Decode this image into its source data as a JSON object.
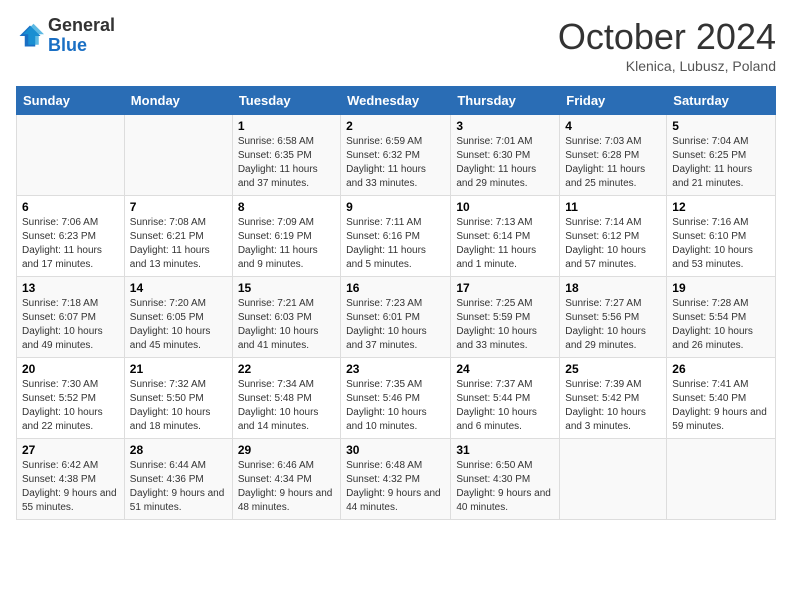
{
  "header": {
    "logo_general": "General",
    "logo_blue": "Blue",
    "title": "October 2024",
    "subtitle": "Klenica, Lubusz, Poland"
  },
  "weekdays": [
    "Sunday",
    "Monday",
    "Tuesday",
    "Wednesday",
    "Thursday",
    "Friday",
    "Saturday"
  ],
  "weeks": [
    [
      {
        "day": "",
        "sunrise": "",
        "sunset": "",
        "daylight": ""
      },
      {
        "day": "",
        "sunrise": "",
        "sunset": "",
        "daylight": ""
      },
      {
        "day": "1",
        "sunrise": "Sunrise: 6:58 AM",
        "sunset": "Sunset: 6:35 PM",
        "daylight": "Daylight: 11 hours and 37 minutes."
      },
      {
        "day": "2",
        "sunrise": "Sunrise: 6:59 AM",
        "sunset": "Sunset: 6:32 PM",
        "daylight": "Daylight: 11 hours and 33 minutes."
      },
      {
        "day": "3",
        "sunrise": "Sunrise: 7:01 AM",
        "sunset": "Sunset: 6:30 PM",
        "daylight": "Daylight: 11 hours and 29 minutes."
      },
      {
        "day": "4",
        "sunrise": "Sunrise: 7:03 AM",
        "sunset": "Sunset: 6:28 PM",
        "daylight": "Daylight: 11 hours and 25 minutes."
      },
      {
        "day": "5",
        "sunrise": "Sunrise: 7:04 AM",
        "sunset": "Sunset: 6:25 PM",
        "daylight": "Daylight: 11 hours and 21 minutes."
      }
    ],
    [
      {
        "day": "6",
        "sunrise": "Sunrise: 7:06 AM",
        "sunset": "Sunset: 6:23 PM",
        "daylight": "Daylight: 11 hours and 17 minutes."
      },
      {
        "day": "7",
        "sunrise": "Sunrise: 7:08 AM",
        "sunset": "Sunset: 6:21 PM",
        "daylight": "Daylight: 11 hours and 13 minutes."
      },
      {
        "day": "8",
        "sunrise": "Sunrise: 7:09 AM",
        "sunset": "Sunset: 6:19 PM",
        "daylight": "Daylight: 11 hours and 9 minutes."
      },
      {
        "day": "9",
        "sunrise": "Sunrise: 7:11 AM",
        "sunset": "Sunset: 6:16 PM",
        "daylight": "Daylight: 11 hours and 5 minutes."
      },
      {
        "day": "10",
        "sunrise": "Sunrise: 7:13 AM",
        "sunset": "Sunset: 6:14 PM",
        "daylight": "Daylight: 11 hours and 1 minute."
      },
      {
        "day": "11",
        "sunrise": "Sunrise: 7:14 AM",
        "sunset": "Sunset: 6:12 PM",
        "daylight": "Daylight: 10 hours and 57 minutes."
      },
      {
        "day": "12",
        "sunrise": "Sunrise: 7:16 AM",
        "sunset": "Sunset: 6:10 PM",
        "daylight": "Daylight: 10 hours and 53 minutes."
      }
    ],
    [
      {
        "day": "13",
        "sunrise": "Sunrise: 7:18 AM",
        "sunset": "Sunset: 6:07 PM",
        "daylight": "Daylight: 10 hours and 49 minutes."
      },
      {
        "day": "14",
        "sunrise": "Sunrise: 7:20 AM",
        "sunset": "Sunset: 6:05 PM",
        "daylight": "Daylight: 10 hours and 45 minutes."
      },
      {
        "day": "15",
        "sunrise": "Sunrise: 7:21 AM",
        "sunset": "Sunset: 6:03 PM",
        "daylight": "Daylight: 10 hours and 41 minutes."
      },
      {
        "day": "16",
        "sunrise": "Sunrise: 7:23 AM",
        "sunset": "Sunset: 6:01 PM",
        "daylight": "Daylight: 10 hours and 37 minutes."
      },
      {
        "day": "17",
        "sunrise": "Sunrise: 7:25 AM",
        "sunset": "Sunset: 5:59 PM",
        "daylight": "Daylight: 10 hours and 33 minutes."
      },
      {
        "day": "18",
        "sunrise": "Sunrise: 7:27 AM",
        "sunset": "Sunset: 5:56 PM",
        "daylight": "Daylight: 10 hours and 29 minutes."
      },
      {
        "day": "19",
        "sunrise": "Sunrise: 7:28 AM",
        "sunset": "Sunset: 5:54 PM",
        "daylight": "Daylight: 10 hours and 26 minutes."
      }
    ],
    [
      {
        "day": "20",
        "sunrise": "Sunrise: 7:30 AM",
        "sunset": "Sunset: 5:52 PM",
        "daylight": "Daylight: 10 hours and 22 minutes."
      },
      {
        "day": "21",
        "sunrise": "Sunrise: 7:32 AM",
        "sunset": "Sunset: 5:50 PM",
        "daylight": "Daylight: 10 hours and 18 minutes."
      },
      {
        "day": "22",
        "sunrise": "Sunrise: 7:34 AM",
        "sunset": "Sunset: 5:48 PM",
        "daylight": "Daylight: 10 hours and 14 minutes."
      },
      {
        "day": "23",
        "sunrise": "Sunrise: 7:35 AM",
        "sunset": "Sunset: 5:46 PM",
        "daylight": "Daylight: 10 hours and 10 minutes."
      },
      {
        "day": "24",
        "sunrise": "Sunrise: 7:37 AM",
        "sunset": "Sunset: 5:44 PM",
        "daylight": "Daylight: 10 hours and 6 minutes."
      },
      {
        "day": "25",
        "sunrise": "Sunrise: 7:39 AM",
        "sunset": "Sunset: 5:42 PM",
        "daylight": "Daylight: 10 hours and 3 minutes."
      },
      {
        "day": "26",
        "sunrise": "Sunrise: 7:41 AM",
        "sunset": "Sunset: 5:40 PM",
        "daylight": "Daylight: 9 hours and 59 minutes."
      }
    ],
    [
      {
        "day": "27",
        "sunrise": "Sunrise: 6:42 AM",
        "sunset": "Sunset: 4:38 PM",
        "daylight": "Daylight: 9 hours and 55 minutes."
      },
      {
        "day": "28",
        "sunrise": "Sunrise: 6:44 AM",
        "sunset": "Sunset: 4:36 PM",
        "daylight": "Daylight: 9 hours and 51 minutes."
      },
      {
        "day": "29",
        "sunrise": "Sunrise: 6:46 AM",
        "sunset": "Sunset: 4:34 PM",
        "daylight": "Daylight: 9 hours and 48 minutes."
      },
      {
        "day": "30",
        "sunrise": "Sunrise: 6:48 AM",
        "sunset": "Sunset: 4:32 PM",
        "daylight": "Daylight: 9 hours and 44 minutes."
      },
      {
        "day": "31",
        "sunrise": "Sunrise: 6:50 AM",
        "sunset": "Sunset: 4:30 PM",
        "daylight": "Daylight: 9 hours and 40 minutes."
      },
      {
        "day": "",
        "sunrise": "",
        "sunset": "",
        "daylight": ""
      },
      {
        "day": "",
        "sunrise": "",
        "sunset": "",
        "daylight": ""
      }
    ]
  ]
}
